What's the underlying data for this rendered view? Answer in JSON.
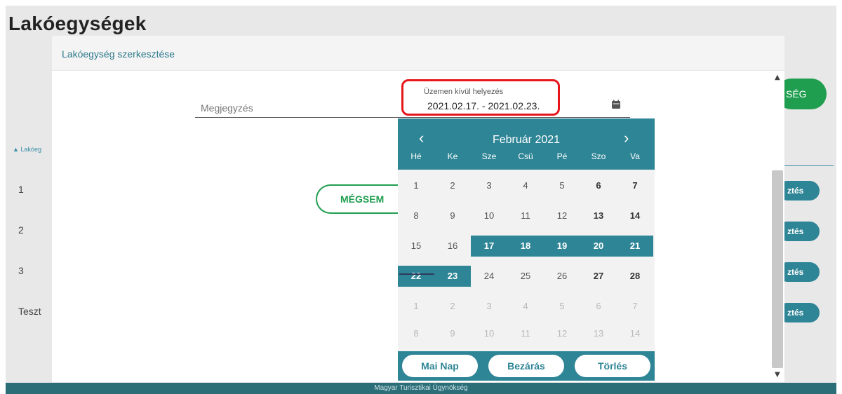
{
  "page": {
    "title": "Lakóegységek",
    "add_button_partial": "SÉG",
    "column_header_partial": "Lakóeg",
    "rows": [
      "1",
      "2",
      "3",
      "Teszt"
    ],
    "edit_button_partial": "ztés",
    "footer_text": "Magyar Turisztikai Ügynökség"
  },
  "modal": {
    "title": "Lakóegység szerkesztése",
    "note_placeholder": "Megjegyzés",
    "date_field_label": "Üzemen kívül helyezés",
    "date_field_value": "2021.02.17. - 2021.02.23.",
    "cancel_label": "MÉGSEM"
  },
  "datepicker": {
    "month_label": "Február 2021",
    "prev_icon": "‹",
    "next_icon": "›",
    "weekdays": [
      "Hé",
      "Ke",
      "Sze",
      "Csü",
      "Pé",
      "Szo",
      "Va"
    ],
    "weeks": [
      [
        "1",
        "2",
        "3",
        "4",
        "5",
        "6",
        "7"
      ],
      [
        "8",
        "9",
        "10",
        "11",
        "12",
        "13",
        "14"
      ],
      [
        "15",
        "16",
        "17",
        "18",
        "19",
        "20",
        "21"
      ],
      [
        "22",
        "23",
        "24",
        "25",
        "26",
        "27",
        "28"
      ],
      [
        "1",
        "2",
        "3",
        "4",
        "5",
        "6",
        "7"
      ],
      [
        "8",
        "9",
        "10",
        "11",
        "12",
        "13",
        "14"
      ]
    ],
    "selected_range": [
      "2021.02.17.",
      "2021.02.23."
    ],
    "today": "1",
    "buttons": {
      "today": "Mai Nap",
      "close": "Bezárás",
      "clear": "Törlés"
    }
  },
  "colors": {
    "accent": "#2e8596",
    "green": "#1f9e4f",
    "highlight": "#e5151a"
  }
}
